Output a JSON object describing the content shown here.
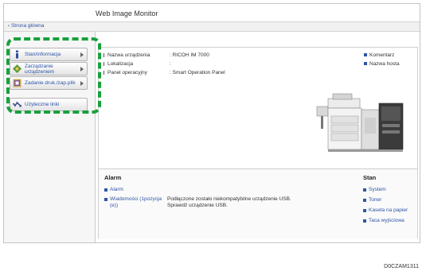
{
  "app": {
    "title": "Web Image Monitor"
  },
  "breadcrumb": "‹ Strona główna",
  "sidebar": {
    "items": [
      {
        "label": "Stan/informacja",
        "icon": "info-icon"
      },
      {
        "label": "Zarządzanie urządzeniem",
        "icon": "device-management-icon"
      },
      {
        "label": "Zadanie druk./zap.plik",
        "icon": "print-job-icon"
      },
      {
        "label": "Użyteczne linki",
        "icon": "link-icon"
      }
    ]
  },
  "device_info": [
    {
      "label": "Nazwa urządzenia",
      "value": ": RICOH IM 7000"
    },
    {
      "label": "Lokalizacja",
      "value": ":"
    },
    {
      "label": "Panel operacyjny",
      "value": ": Smart Operation Panel"
    }
  ],
  "side_links": [
    "Komentarz",
    "Nazwa hosta"
  ],
  "alarm": {
    "title": "Alarm",
    "link": "Alarm",
    "message_link": "Wiadomości (1pozycja\n(e))",
    "message": "Podłączone zostało niekompatybilne urządzenie USB.\nSprawdź urządzenie USB."
  },
  "status": {
    "title": "Stan",
    "links": [
      "System",
      "Toner",
      "Kaseta na papier",
      "Taca wyjściowa"
    ]
  },
  "caption": "D0CZAM1311",
  "colors": {
    "highlight": "#18a13c",
    "link": "#2f54a6"
  }
}
